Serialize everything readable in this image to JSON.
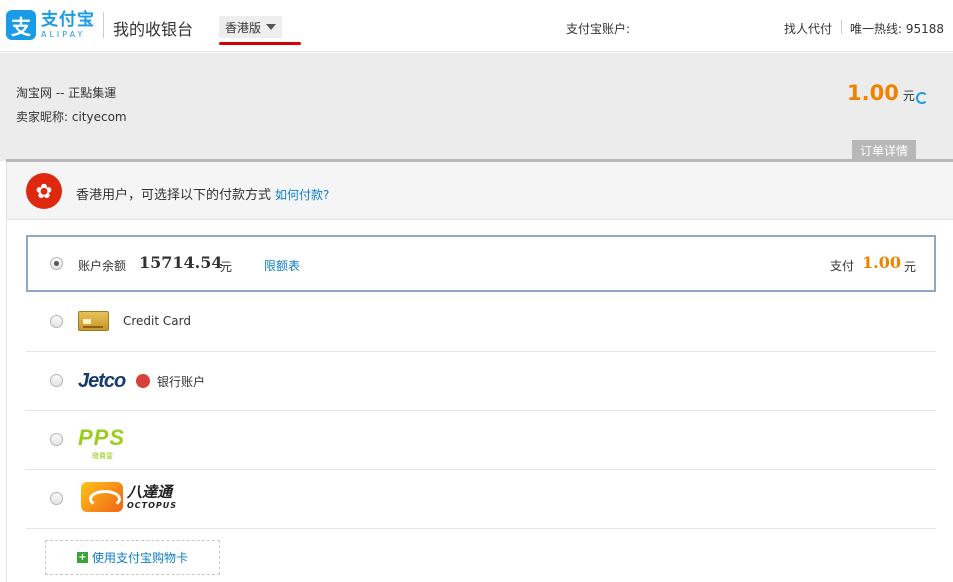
{
  "header": {
    "logo_mark": "支",
    "logo_cn": "支付宝",
    "logo_en": "ALIPAY",
    "title": "我的收银台",
    "region": "香港版",
    "account_label": "支付宝账户:",
    "help_link": "找人代付",
    "hotline": "唯一热线: 95188"
  },
  "order": {
    "merchant": "淘宝网 -- 正點集運",
    "seller": "卖家昵称: cityecom",
    "amount": "1.00",
    "amount_unit": "元",
    "detail_tab": "订单详情"
  },
  "notice": {
    "flag_glyph": "✿",
    "text": "香港用户，可选择以下的付款方式",
    "link": "如何付款?"
  },
  "methods": {
    "balance": {
      "label": "账户余额",
      "amount": "15714.54",
      "unit": "元",
      "limit_link": "限额表",
      "pay_label": "支付",
      "pay_amount": "1.00",
      "pay_unit": "元",
      "selected": true
    },
    "credit_card": {
      "label": "Credit Card",
      "icon": "credit-card-icon"
    },
    "jetco": {
      "logo": "Jetco",
      "label": "银行账户",
      "icon": "jetco-logo-icon"
    },
    "pps": {
      "logo": "PPS",
      "sub": "繳費靈",
      "icon": "pps-logo-icon"
    },
    "octopus": {
      "logo_cn": "八達通",
      "logo_en": "OCTOPUS",
      "icon": "octopus-logo-icon"
    }
  },
  "gift_card": {
    "label": "使用支付宝购物卡"
  },
  "colors": {
    "brand_blue": "#1a9be8",
    "amount_orange": "#f08200",
    "link_blue": "#0a7fc7",
    "region_underline": "#d40000"
  }
}
